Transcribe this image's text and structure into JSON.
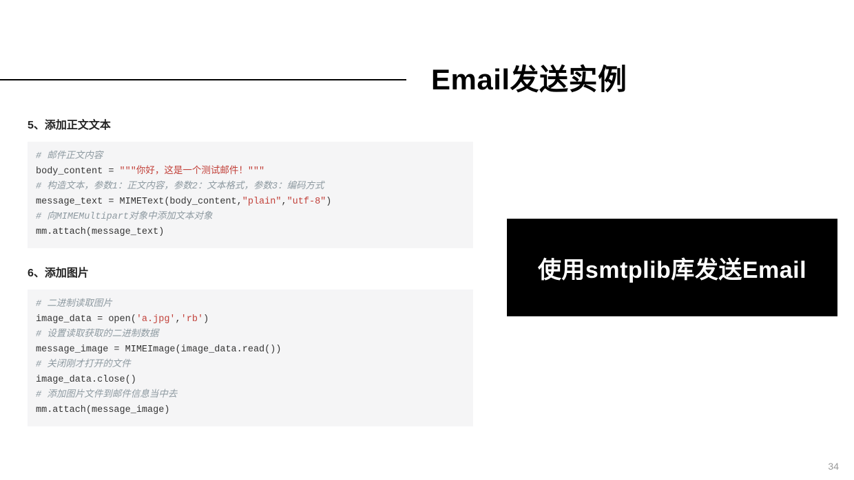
{
  "title": "Email发送实例",
  "callout": "使用smtplib库发送Email",
  "page_number": "34",
  "sections": [
    {
      "heading": "5、添加正文文本",
      "code": [
        {
          "type": "comment",
          "text": "# 邮件正文内容"
        },
        {
          "type": "code_with_strings",
          "prefix": "body_content = ",
          "strings_line": "\"\"\"你好，这是一个测试邮件！\"\"\""
        },
        {
          "type": "comment",
          "text": "# 构造文本，参数1：正文内容，参数2：文本格式，参数3：编码方式"
        },
        {
          "type": "code_two_strings",
          "prefix": "message_text = MIMEText(body_content,",
          "s1": "\"plain\"",
          "mid": ",",
          "s2": "\"utf-8\"",
          "suffix": ")"
        },
        {
          "type": "comment",
          "text": "# 向MIMEMultipart对象中添加文本对象"
        },
        {
          "type": "code",
          "text": "mm.attach(message_text)"
        }
      ]
    },
    {
      "heading": "6、添加图片",
      "code": [
        {
          "type": "comment",
          "text": "# 二进制读取图片"
        },
        {
          "type": "code_two_strings",
          "prefix": "image_data = open(",
          "s1": "'a.jpg'",
          "mid": ",",
          "s2": "'rb'",
          "suffix": ")"
        },
        {
          "type": "comment",
          "text": "# 设置读取获取的二进制数据"
        },
        {
          "type": "code",
          "text": "message_image = MIMEImage(image_data.read())"
        },
        {
          "type": "comment",
          "text": "# 关闭刚才打开的文件"
        },
        {
          "type": "code",
          "text": "image_data.close()"
        },
        {
          "type": "comment",
          "text": "# 添加图片文件到邮件信息当中去"
        },
        {
          "type": "code",
          "text": "mm.attach(message_image)"
        }
      ]
    }
  ]
}
